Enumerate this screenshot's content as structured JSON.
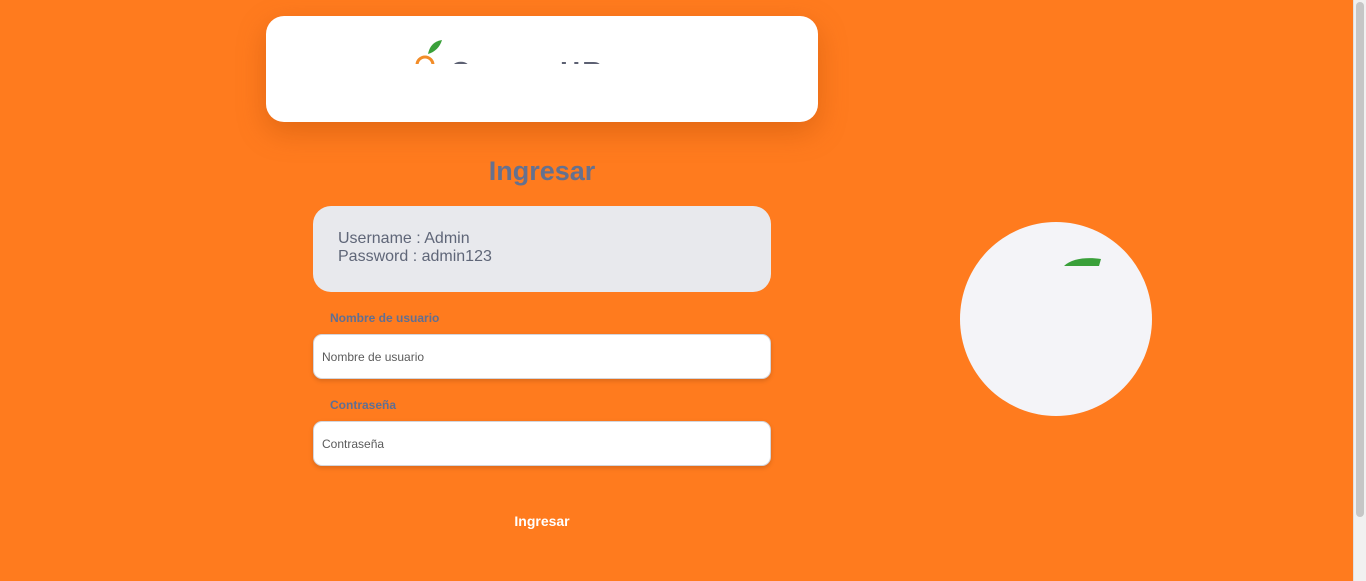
{
  "logo": {
    "text": "OrangeHRM",
    "icon": "orange-fruit-logo-icon",
    "colors": {
      "orange": "#f28c28",
      "leaf": "#3aa03a"
    }
  },
  "login": {
    "title": "Ingresar",
    "credentials": {
      "username_line": "Username : Admin",
      "password_line": "Password : admin123"
    },
    "username": {
      "label": "Nombre de usuario",
      "placeholder": "Nombre de usuario",
      "value": ""
    },
    "password": {
      "label": "Contraseña",
      "placeholder": "Contraseña",
      "value": ""
    },
    "submit_label": "Ingresar"
  },
  "side_illustration": {
    "icon": "orange-leaf-icon",
    "leaf_color": "#3aa03a"
  },
  "theme": {
    "background": "#ff7b1e",
    "card": "#ffffff",
    "credentials_box": "#e8e9ed",
    "title_color": "#65718f",
    "label_color": "#5f6f93"
  }
}
